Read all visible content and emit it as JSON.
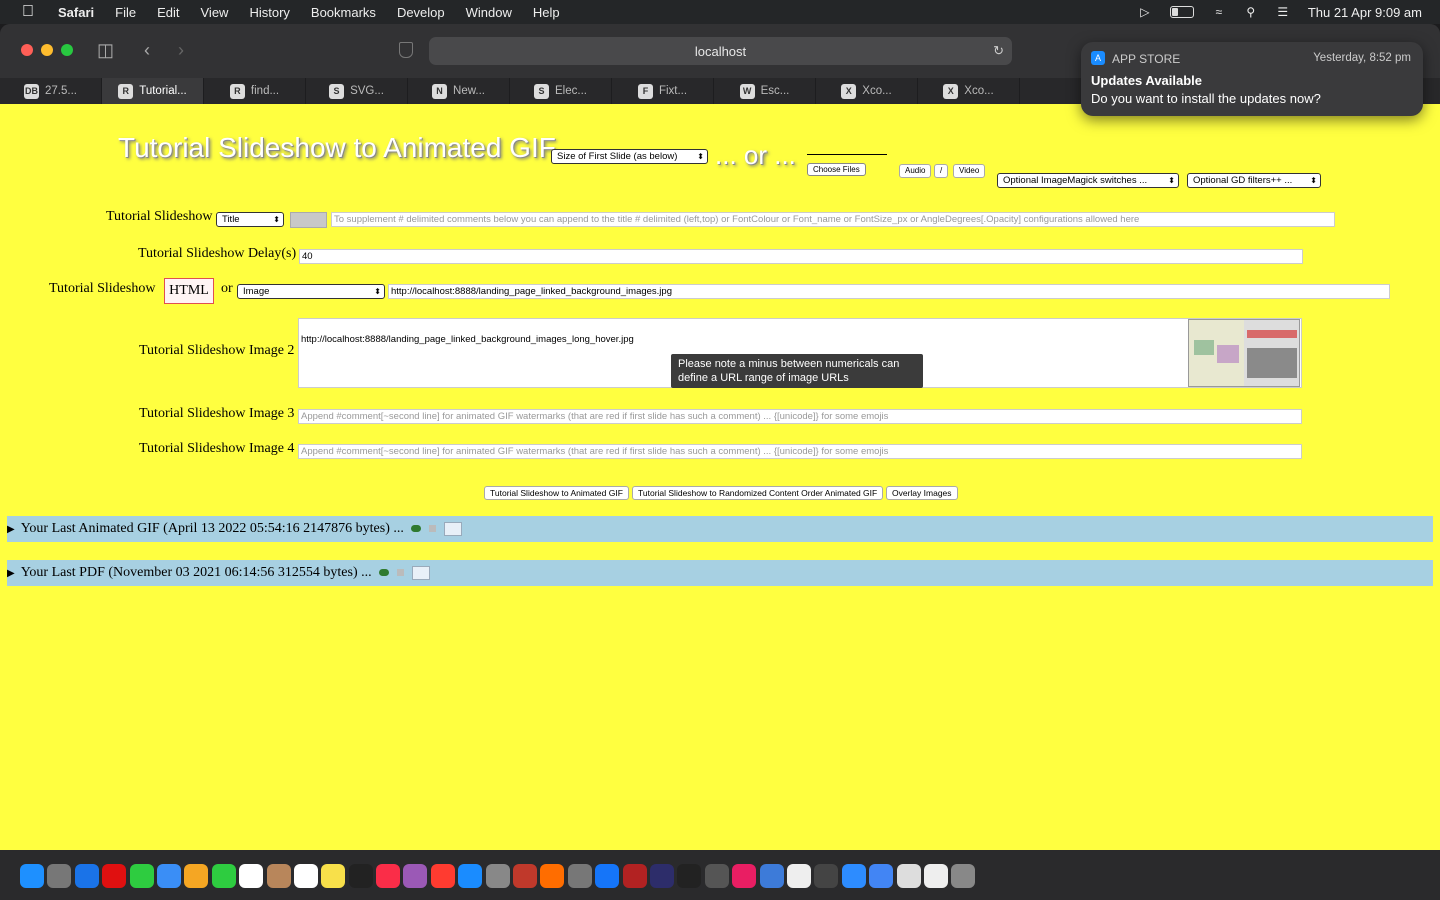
{
  "menubar": {
    "app": "Safari",
    "items": [
      "File",
      "Edit",
      "View",
      "History",
      "Bookmarks",
      "Develop",
      "Window",
      "Help"
    ],
    "clock": "Thu 21 Apr  9:09 am"
  },
  "browser": {
    "address": "localhost",
    "tabs": [
      {
        "label": "27.5...",
        "fav": "DB"
      },
      {
        "label": "Tutorial...",
        "fav": "R"
      },
      {
        "label": "find...",
        "fav": "R"
      },
      {
        "label": "SVG...",
        "fav": "S"
      },
      {
        "label": "New...",
        "fav": "N"
      },
      {
        "label": "Elec...",
        "fav": "S"
      },
      {
        "label": "Fixt...",
        "fav": "F"
      },
      {
        "label": "Esc...",
        "fav": "W"
      },
      {
        "label": "Xco...",
        "fav": "X"
      },
      {
        "label": "Xco...",
        "fav": "X"
      }
    ]
  },
  "notification": {
    "app": "APP STORE",
    "time": "Yesterday, 8:52 pm",
    "title": "Updates Available",
    "body": "Do you want to install the updates now?"
  },
  "page": {
    "heading": "Tutorial Slideshow to Animated GIF",
    "size_select": "Size of First Slide (as below)",
    "or_text": "... or ...",
    "choose_files": "Choose Files",
    "audio": "Audio",
    "slash": "/",
    "video": "Video",
    "imagemagick_select": "Optional ImageMagick switches ...",
    "gd_select": "Optional GD filters++ ...",
    "title_row": {
      "label": "Tutorial Slideshow",
      "select": "Title",
      "placeholder": "To supplement # delimited comments below you can append to the title # delimited (left,top) or FontColour or Font_name or FontSize_px or AngleDegrees[.Opacity] configurations allowed here"
    },
    "delay_row": {
      "label": "Tutorial Slideshow Delay(s)",
      "value": "40"
    },
    "slide1_row": {
      "label": "Tutorial Slideshow",
      "html_button": "HTML",
      "or": "or",
      "select": "Image",
      "value": "http://localhost:8888/landing_page_linked_background_images.jpg"
    },
    "image2_row": {
      "label": "Tutorial Slideshow Image 2",
      "value": "http://localhost:8888/landing_page_linked_background_images_long_hover.jpg"
    },
    "tooltip": "Please note a minus between numericals can define a URL range of image URLs",
    "image3_row": {
      "label": "Tutorial Slideshow Image 3",
      "placeholder": "Append #comment[~second line] for animated GIF watermarks (that are red if first slide has such a comment) ... {[unicode]} for some emojis"
    },
    "image4_row": {
      "label": "Tutorial Slideshow Image 4",
      "placeholder": "Append #comment[~second line] for animated GIF watermarks (that are red if first slide has such a comment) ... {[unicode]} for some emojis"
    },
    "buttons": [
      "Tutorial Slideshow to Animated GIF",
      "Tutorial Slideshow to Randomized Content Order Animated GIF",
      "Overlay Images"
    ],
    "last_gif": "Your Last Animated GIF (April 13 2022 05:54:16 2147876 bytes) ...",
    "last_pdf": "Your Last PDF (November 03 2021 06:14:56 312554 bytes) ..."
  },
  "colors": {
    "page_bg": "#ffff40",
    "details_bg": "#a7d0e2"
  },
  "dock": {
    "icons": [
      "finder-icon",
      "launchpad-icon",
      "safari-icon",
      "opera-icon",
      "messages-icon",
      "mail-icon",
      "photos-icon",
      "facetime-icon",
      "calendar-icon",
      "contacts-icon",
      "reminders-icon",
      "notes-icon",
      "appletv-icon",
      "music-icon",
      "podcasts-icon",
      "news-icon",
      "appstore-icon",
      "settings-icon",
      "pinwheel-icon",
      "firefox-icon",
      "calculator-icon",
      "xcode-icon",
      "filezilla-icon",
      "bbedit-icon",
      "terminal-icon",
      "gimp-icon",
      "intellij-icon",
      "preview-icon",
      "textedit-icon",
      "tool-icon",
      "zoom-icon",
      "chrome-icon",
      "script-icon",
      "pages-icon",
      "folder-icon"
    ],
    "colors": [
      "#1e90ff",
      "#777",
      "#1a73e8",
      "#e01010",
      "#2ecc40",
      "#3a8ef6",
      "#f5a623",
      "#2ecc40",
      "#ffffff",
      "#b8865b",
      "#fff",
      "#f8e04a",
      "#222",
      "#fa2d48",
      "#9b59b6",
      "#ff3b30",
      "#1a8cff",
      "#888",
      "#c0392b",
      "#ff6d00",
      "#777",
      "#1575f9",
      "#b22222",
      "#2d2d6a",
      "#222",
      "#555",
      "#e91e63",
      "#3d7bd9",
      "#eee",
      "#444",
      "#2d8cff",
      "#4285f4",
      "#ddd",
      "#eee",
      "#888"
    ]
  }
}
